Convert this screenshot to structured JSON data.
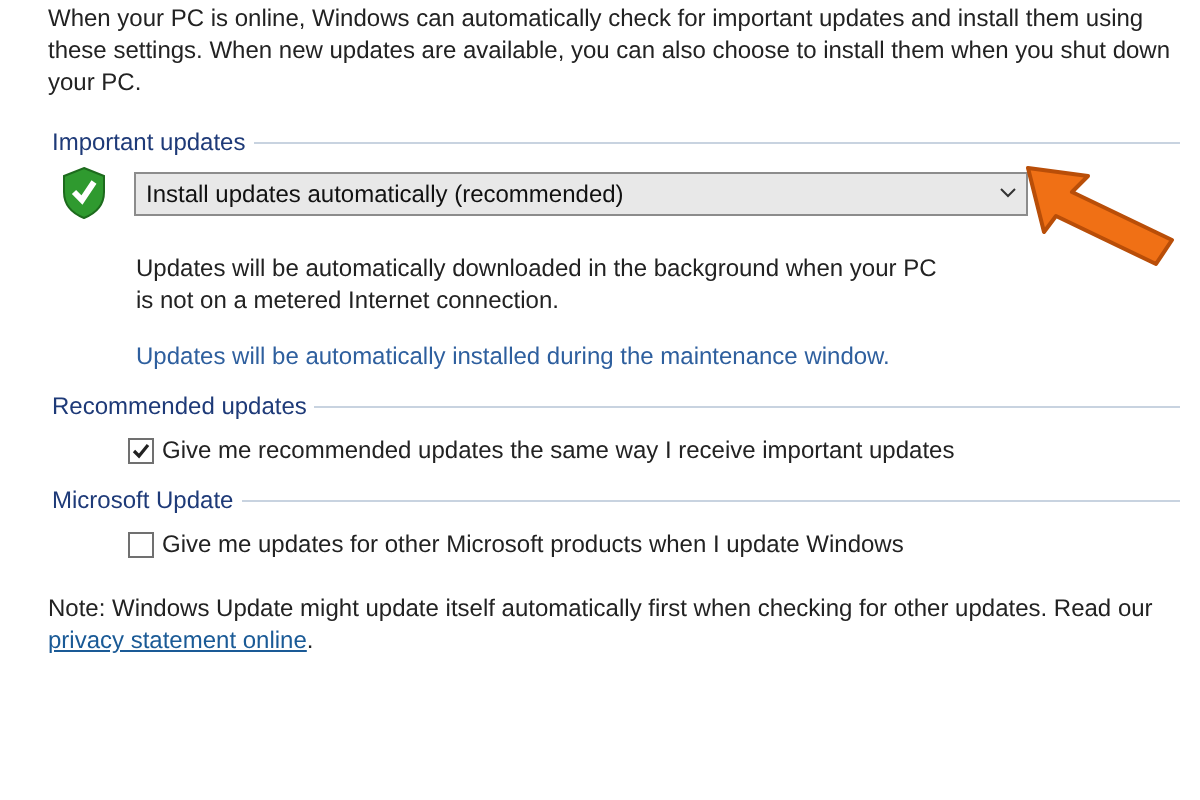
{
  "intro": "When your PC is online, Windows can automatically check for important updates and install them using these settings. When new updates are available, you can also choose to install them when you shut down your PC.",
  "important_updates": {
    "heading": "Important updates",
    "dropdown": {
      "value": "Install updates automatically (recommended)"
    },
    "description": "Updates will be automatically downloaded in the background when your PC is not on a metered Internet connection.",
    "schedule_link": "Updates will be automatically installed during the maintenance window."
  },
  "sections": [
    {
      "heading": "Recommended updates",
      "option": {
        "label": "Give me recommended updates the same way I receive important updates",
        "checked": true
      }
    },
    {
      "heading": "Microsoft Update",
      "option": {
        "label": "Give me updates for other Microsoft products when I update Windows",
        "checked": false
      }
    }
  ],
  "note": {
    "text": "Note: Windows Update might update itself automatically first when checking for other updates.  Read our",
    "link": "privacy statement online",
    "end": "."
  }
}
